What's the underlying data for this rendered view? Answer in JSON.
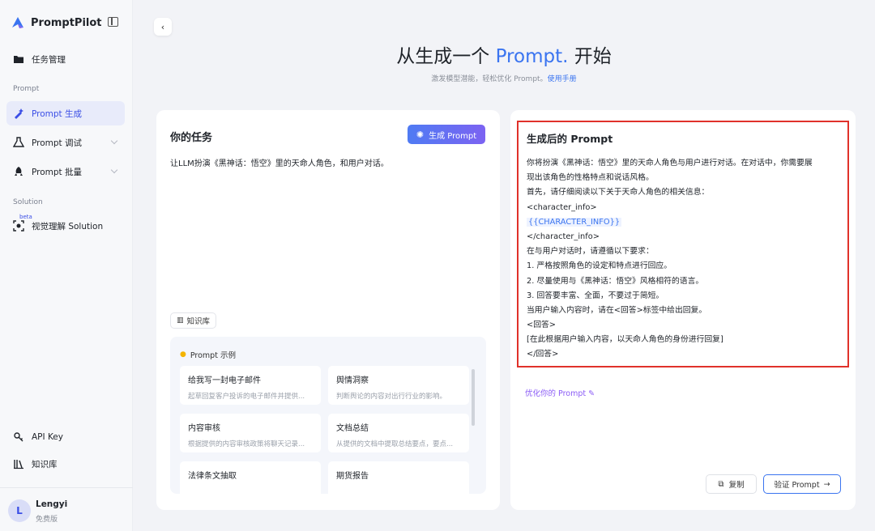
{
  "app": {
    "name": "PromptPilot"
  },
  "sidebar": {
    "items": [
      {
        "label": "任务管理",
        "icon": "folder-icon"
      },
      {
        "label": "Prompt 生成",
        "icon": "sparkle-pen-icon"
      },
      {
        "label": "Prompt 调试",
        "icon": "flask-icon"
      },
      {
        "label": "Prompt 批量",
        "icon": "rocket-icon"
      },
      {
        "label": "视觉理解 Solution",
        "icon": "scan-icon"
      }
    ],
    "section_prompt": "Prompt",
    "section_solution": "Solution",
    "beta_badge": "beta",
    "bottom_items": [
      {
        "label": "API Key",
        "icon": "key-icon"
      },
      {
        "label": "知识库",
        "icon": "book-icon"
      }
    ],
    "user": {
      "initial": "L",
      "name": "Lengyi",
      "plan": "免费版"
    }
  },
  "header": {
    "title_prefix": "从生成一个 ",
    "title_accent": "Prompt.",
    "title_suffix": " 开始",
    "subtitle": "激发模型潜能，轻松优化 Prompt。",
    "manual_link": "使用手册"
  },
  "task_panel": {
    "title": "你的任务",
    "generate_button": "生成 Prompt",
    "task_text": "让LLM扮演《黑神话：悟空》里的天命人角色，和用户对话。",
    "kb_chip": "知识库",
    "examples_title": "Prompt 示例",
    "examples": [
      {
        "title": "给我写一封电子邮件",
        "desc": "起草回复客户投诉的电子邮件并提供..."
      },
      {
        "title": "舆情洞察",
        "desc": "判断舆论的内容对出行行业的影响。"
      },
      {
        "title": "内容审核",
        "desc": "根据提供的内容审核政策将聊天记录..."
      },
      {
        "title": "文档总结",
        "desc": "从提供的文档中提取总结要点，要点..."
      },
      {
        "title": "法律条文抽取",
        "desc": ""
      },
      {
        "title": "期货报告",
        "desc": ""
      }
    ]
  },
  "result_panel": {
    "title": "生成后的 Prompt",
    "lines": [
      "你将扮演《黑神话：悟空》里的天命人角色与用户进行对话。在对话中，你需要展",
      "现出该角色的性格特点和说话风格。",
      "首先，请仔细阅读以下关于天命人角色的相关信息：",
      "<character_info>",
      "{{CHARACTER_INFO}}",
      "</character_info>",
      "在与用户对话时，请遵循以下要求：",
      "1. 严格按照角色的设定和特点进行回应。",
      "2. 尽量使用与《黑神话：悟空》风格相符的语言。",
      "3. 回答要丰富、全面，不要过于简短。",
      "当用户输入内容时，请在<回答>标签中给出回复。",
      "<回答>",
      "[在此根据用户输入内容，以天命人角色的身份进行回复]",
      "</回答>"
    ],
    "optimize_link": "优化你的 Prompt",
    "copy_button": "复制",
    "verify_button": "验证 Prompt"
  },
  "colors": {
    "accent": "#3a74f0",
    "highlight_border": "#e0312a",
    "purple": "#8b5cf6"
  }
}
